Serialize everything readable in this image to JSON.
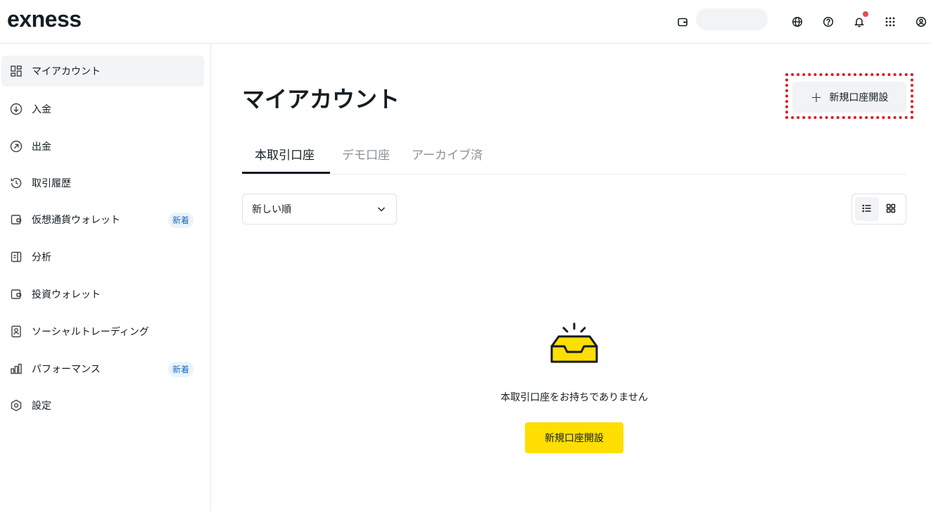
{
  "header": {
    "logo": "exness",
    "icons": [
      "wallet-icon",
      "globe-icon",
      "help-icon",
      "bell-icon",
      "apps-grid-icon",
      "user-icon"
    ],
    "notification_color": "#ea4c4c"
  },
  "sidebar": {
    "items": [
      {
        "label": "マイアカウント",
        "icon": "dashboard-icon",
        "active": true
      },
      {
        "label": "入金",
        "icon": "deposit-icon"
      },
      {
        "label": "出金",
        "icon": "withdraw-icon"
      },
      {
        "label": "取引履歴",
        "icon": "history-icon"
      },
      {
        "label": "仮想通貨ウォレット",
        "icon": "wallet-icon",
        "badge": "新着"
      },
      {
        "label": "分析",
        "icon": "analytics-icon"
      },
      {
        "label": "投資ウォレット",
        "icon": "wallet-icon"
      },
      {
        "label": "ソーシャルトレーディング",
        "icon": "social-trading-icon"
      },
      {
        "label": "パフォーマンス",
        "icon": "performance-icon",
        "badge": "新着"
      },
      {
        "label": "設定",
        "icon": "settings-icon"
      }
    ]
  },
  "main": {
    "title": "マイアカウント",
    "new_account_button": "新規口座開設",
    "tabs": [
      {
        "label": "本取引口座",
        "active": true
      },
      {
        "label": "デモ口座"
      },
      {
        "label": "アーカイブ済"
      }
    ],
    "sort": {
      "value": "新しい順"
    },
    "empty_state": {
      "message": "本取引口座をお持ちでありません",
      "cta": "新規口座開設"
    }
  },
  "colors": {
    "accent": "#ffde02",
    "text": "#141d22",
    "badge_bg": "#e9f3fb",
    "badge_text": "#1f6fb8",
    "highlight_outline": "#e0141e"
  }
}
